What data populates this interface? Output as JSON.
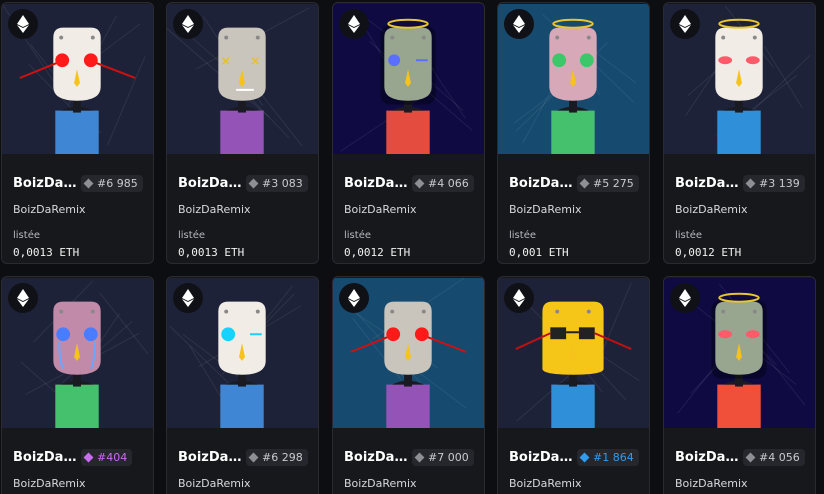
{
  "cards": [
    {
      "name": "BoizDaRemix",
      "token": "#6 985",
      "collection": "BoizDaRemix",
      "status": "listée",
      "price": "0,0013 ETH",
      "rarity": "common",
      "bg": "#1e2238",
      "shirt": "#3f86d4",
      "face": "#f1ede6",
      "eyes": "red",
      "halo": false
    },
    {
      "name": "BoizDaRemix",
      "token": "#3 083",
      "collection": "BoizDaRemix",
      "status": "listée",
      "price": "0,0013 ETH",
      "rarity": "common",
      "bg": "#1e2238",
      "shirt": "#9453b7",
      "face": "#c9c4bc",
      "eyes": "x",
      "halo": false
    },
    {
      "name": "BoizDaRemix",
      "token": "#4 066",
      "collection": "BoizDaRemix",
      "status": "listée",
      "price": "0,0012 ETH",
      "rarity": "common",
      "bg": "#0f0a42",
      "shirt": "#e34c3e",
      "face": "#98a58f",
      "eyes": "blue",
      "halo": true
    },
    {
      "name": "BoizDaRemix",
      "token": "#5 275",
      "collection": "BoizDaRemix",
      "status": "listée",
      "price": "0,001 ETH",
      "rarity": "common",
      "bg": "#164a6e",
      "shirt": "#45c06d",
      "face": "#d6a8b8",
      "eyes": "green",
      "halo": true
    },
    {
      "name": "BoizDaRemix",
      "token": "#3 139",
      "collection": "BoizDaRemix",
      "status": "listée",
      "price": "0,0012 ETH",
      "rarity": "common",
      "bg": "#1e2238",
      "shirt": "#2f8fd8",
      "face": "#f1ede6",
      "eyes": "pink",
      "halo": true
    },
    {
      "name": "BoizDaRemix",
      "token": "#404",
      "collection": "BoizDaRemix",
      "status": "",
      "price": "",
      "rarity": "epic",
      "bg": "#1e2238",
      "shirt": "#45c06d",
      "face": "#c18aa8",
      "eyes": "blue2",
      "halo": false
    },
    {
      "name": "BoizDaRemix",
      "token": "#6 298",
      "collection": "BoizDaRemix",
      "status": "",
      "price": "",
      "rarity": "common",
      "bg": "#1e2238",
      "shirt": "#3f86d4",
      "face": "#f1ede6",
      "eyes": "cyan",
      "halo": false
    },
    {
      "name": "BoizDaRemix",
      "token": "#7 000",
      "collection": "BoizDaRemix",
      "status": "",
      "price": "",
      "rarity": "common",
      "bg": "#164a6e",
      "shirt": "#9453b7",
      "face": "#c9c4bc",
      "eyes": "red",
      "halo": false
    },
    {
      "name": "BoizDaRemix",
      "token": "#1 864",
      "collection": "BoizDaRemix",
      "status": "",
      "price": "",
      "rarity": "rare",
      "bg": "#1e2238",
      "shirt": "#2f8fd8",
      "face": "#f5c518",
      "eyes": "shades",
      "halo": false
    },
    {
      "name": "BoizDaRemix",
      "token": "#4 056",
      "collection": "BoizDaRemix",
      "status": "",
      "price": "",
      "rarity": "common",
      "bg": "#0f0a42",
      "shirt": "#f0503a",
      "face": "#98a58f",
      "eyes": "pink",
      "halo": true
    }
  ],
  "colors": {
    "epic": "#c86cf0",
    "rare": "#2f9cf0",
    "common": "#8e8e95"
  }
}
